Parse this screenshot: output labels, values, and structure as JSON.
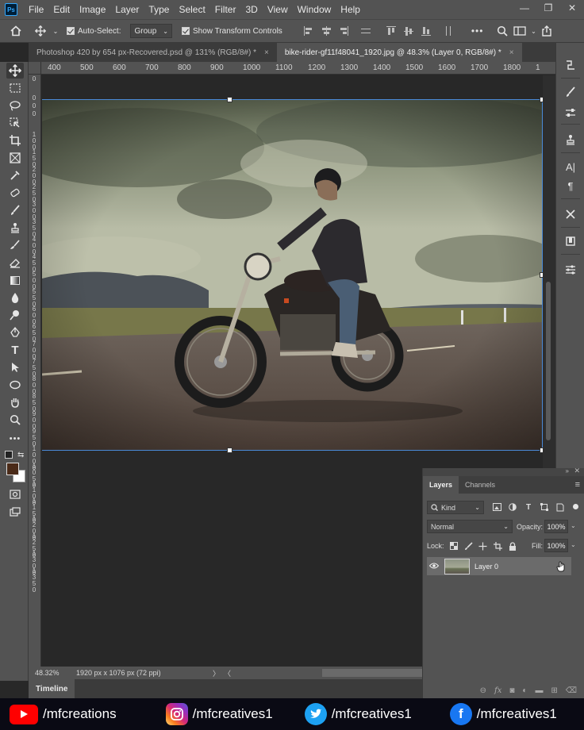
{
  "app": {
    "logo_text": "Ps"
  },
  "menu": [
    "File",
    "Edit",
    "Image",
    "Layer",
    "Type",
    "Select",
    "Filter",
    "3D",
    "View",
    "Window",
    "Help"
  ],
  "window_controls": {
    "minimize": "—",
    "restore": "❐",
    "close": "✕"
  },
  "options_bar": {
    "auto_select_label": "Auto-Select:",
    "auto_select_target": "Group",
    "show_transform_label": "Show Transform Controls",
    "more_label": "•••"
  },
  "tabs": [
    {
      "label": "Photoshop 420 by 654 px-Recovered.psd @ 131% (RGB/8#) *",
      "close": "×"
    },
    {
      "label": "bike-rider-gf11f48041_1920.jpg @ 48.3% (Layer 0, RGB/8#) *",
      "close": "×"
    }
  ],
  "ruler_top_labels": [
    "400",
    "500",
    "600",
    "700",
    "800",
    "900",
    "1000",
    "1100",
    "1200",
    "1300",
    "1400",
    "1500",
    "1600",
    "1700",
    "1800",
    "1"
  ],
  "ruler_left_labels": [
    "0",
    "0",
    "0",
    "0",
    "1 0 0",
    "1 5 0",
    "2 0 0",
    "2 5 0",
    "3 0 0",
    "3 5 0",
    "4 0 0",
    "4 5 0",
    "5 0 0",
    "5 5 0",
    "6 0 0",
    "6 5 0",
    "7 0 0",
    "7 5 0",
    "8 0 0",
    "8 5 0",
    "9 0 0",
    "9 5 0",
    "1 0 0 0",
    "1 0 5 0",
    "1 1 0 0",
    "1 1 5 0",
    "1 2 0 0",
    "1 2 5 0",
    "1 3 0 0",
    "1 3 5 0"
  ],
  "status": {
    "zoom": "48.32%",
    "doc_info": "1920 px x 1076 px (72 ppi)",
    "next_arrow": "〉",
    "prev_arrow": "〈"
  },
  "timeline": {
    "label": "Timeline"
  },
  "layers_panel": {
    "tab_layers": "Layers",
    "tab_channels": "Channels",
    "kind_label": "Kind",
    "blend_mode": "Normal",
    "opacity_label": "Opacity:",
    "opacity_value": "100%",
    "lock_label": "Lock:",
    "fill_label": "Fill:",
    "fill_value": "100%",
    "layers": [
      {
        "name": "Layer 0",
        "visible": true
      }
    ]
  },
  "social": [
    {
      "platform": "youtube",
      "handle": "/mfcreations",
      "color": "#ff0000"
    },
    {
      "platform": "instagram",
      "handle": "/mfcreatives1",
      "color": "#d6249f"
    },
    {
      "platform": "twitter",
      "handle": "/mfcreatives1",
      "color": "#1da1f2"
    },
    {
      "platform": "facebook",
      "handle": "/mfcreatives1",
      "color": "#1877f2"
    }
  ]
}
